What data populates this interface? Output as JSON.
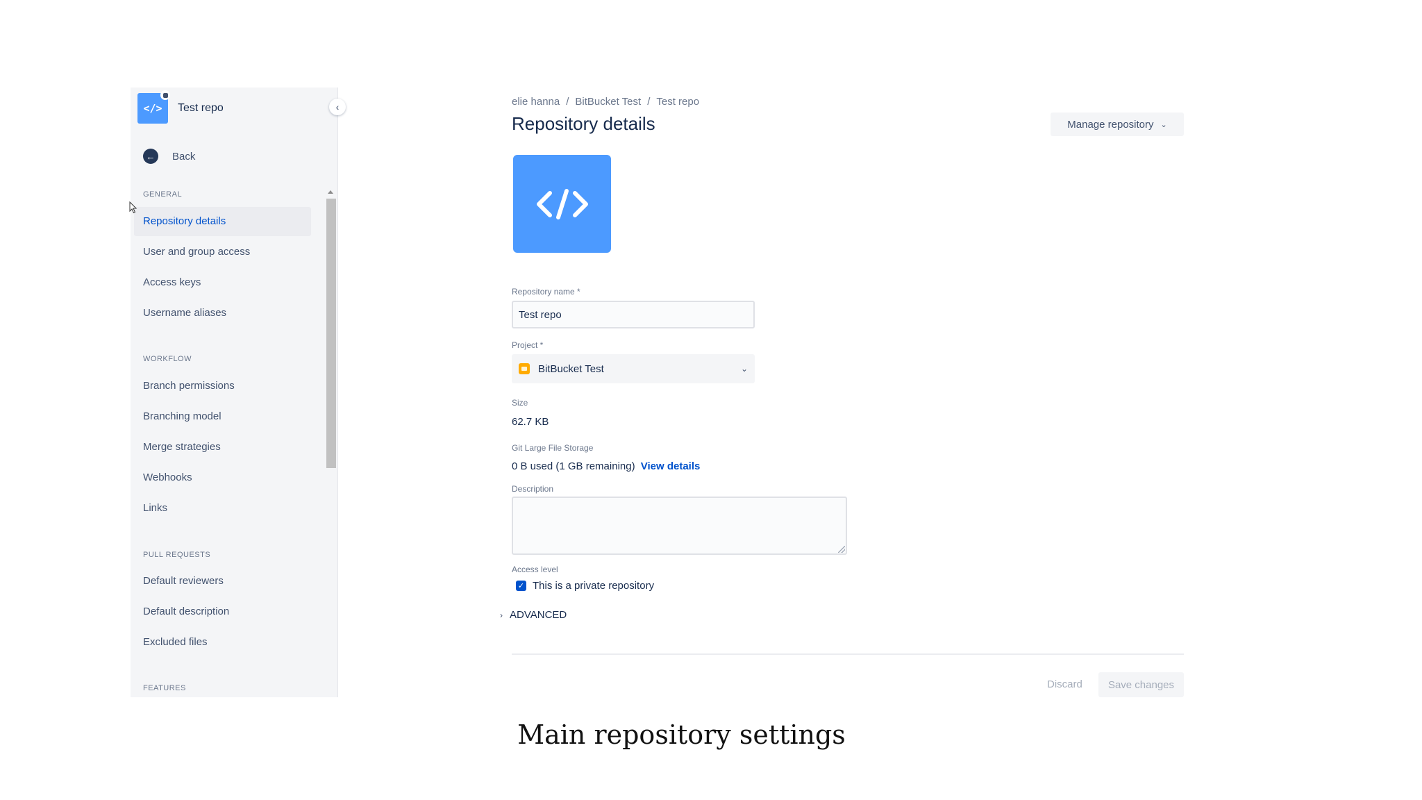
{
  "sidebar": {
    "repo_name": "Test repo",
    "repo_icon": "code-icon",
    "back_label": "Back",
    "sections": [
      {
        "title": "GENERAL",
        "items": [
          "Repository details",
          "User and group access",
          "Access keys",
          "Username aliases"
        ]
      },
      {
        "title": "WORKFLOW",
        "items": [
          "Branch permissions",
          "Branching model",
          "Merge strategies",
          "Webhooks",
          "Links"
        ]
      },
      {
        "title": "PULL REQUESTS",
        "items": [
          "Default reviewers",
          "Default description",
          "Excluded files"
        ]
      },
      {
        "title": "FEATURES",
        "items": []
      }
    ],
    "active_item": "Repository details"
  },
  "header": {
    "breadcrumb": [
      "elie hanna",
      "BitBucket Test",
      "Test repo"
    ],
    "breadcrumb_sep": "/",
    "title": "Repository details",
    "manage_label": "Manage repository"
  },
  "form": {
    "name_label": "Repository name *",
    "name_value": "Test repo",
    "project_label": "Project *",
    "project_value": "BitBucket Test",
    "size_label": "Size",
    "size_value": "62.7 KB",
    "lfs_label": "Git Large File Storage",
    "lfs_value": "0 B used (1 GB remaining)",
    "lfs_link": "View details",
    "description_label": "Description",
    "description_value": "",
    "access_label": "Access level",
    "private_label": "This is a private repository",
    "private_checked": true,
    "advanced_label": "ADVANCED"
  },
  "footer": {
    "discard_label": "Discard",
    "save_label": "Save changes"
  },
  "caption": "Main repository settings",
  "colors": {
    "accent": "#0052cc",
    "repo_avatar": "#4c9aff",
    "project_icon": "#ffab00"
  }
}
